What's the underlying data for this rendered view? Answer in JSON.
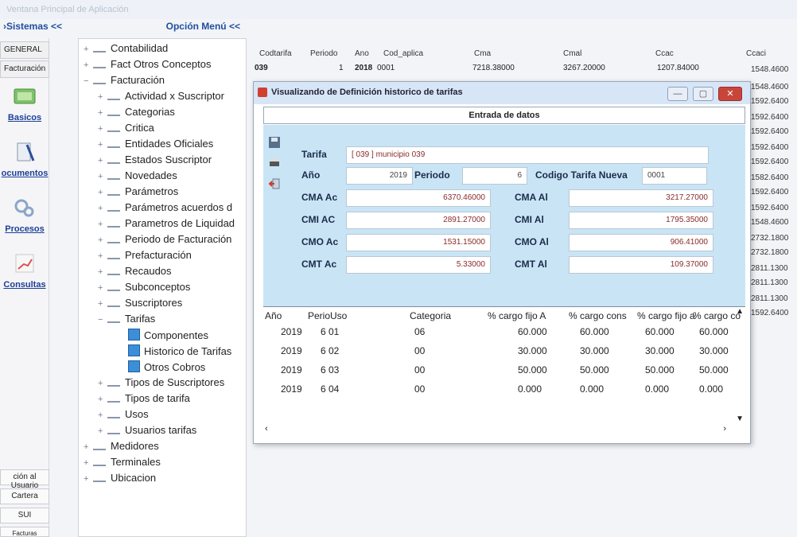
{
  "window": {
    "title": "Ventana Principal de Aplicación"
  },
  "header": {
    "sistemas_label": "›Sistemas <<",
    "opcion_menu_label": "Opción Menú <<"
  },
  "sidebar": {
    "tabs": [
      "GENERAL",
      "Facturación"
    ],
    "big_items": [
      "Basicos",
      "ocumentos",
      "Procesos",
      "Consultas"
    ],
    "bottom_items": [
      "ción al Usuario",
      "Cartera",
      "SUI",
      "Facturas"
    ]
  },
  "tree": {
    "items": [
      "Contabilidad",
      "Fact Otros Conceptos",
      "Facturación",
      "Actividad x Suscriptor",
      "Categorias",
      "Critica",
      "Entidades Oficiales",
      "Estados Suscriptor",
      "Novedades",
      "Parámetros",
      "Parámetros acuerdos d",
      "Parametros de Liquidad",
      "Periodo de Facturación",
      "Prefacturación",
      "Recaudos",
      "Subconceptos",
      "Suscriptores",
      "Tarifas",
      "Componentes",
      "Historico de Tarifas",
      "Otros Cobros",
      "Tipos de Suscriptores",
      "Tipos de tarifa",
      "Usos",
      "Usuarios tarifas",
      "Medidores",
      "Terminales",
      "Ubicacion"
    ]
  },
  "main_grid": {
    "headers": [
      "Codtarifa",
      "Periodo",
      "Ano",
      "Cod_aplica",
      "Cma",
      "Cmal",
      "Ccac",
      "Ccaci"
    ],
    "row1": [
      "039",
      "1",
      "2018",
      "0001",
      "7218.38000",
      "3267.20000",
      "1207.84000"
    ],
    "ccaci_values": [
      "1548.4600",
      "1548.4600",
      "1592.6400",
      "1592.6400",
      "1592.6400",
      "1592.6400",
      "1592.6400",
      "1582.6400",
      "1592.6400",
      "1592.6400",
      "1548.4600",
      "2732.1800",
      "2732.1800",
      "2811.1300",
      "2811.1300",
      "2811.1300",
      "1592.6400"
    ]
  },
  "modal": {
    "title": "Visualizando de Definición historico de tarifas",
    "entrada_label": "Entrada de datos",
    "form": {
      "tarifa_label": "Tarifa",
      "tarifa_value": "[ 039 ] municipio 039",
      "ano_label": "Año",
      "ano_value": "2019",
      "periodo_label": "Periodo",
      "periodo_value": "6",
      "codigo_label": "Codigo Tarifa Nueva",
      "codigo_value": "0001",
      "cma_ac_label": "CMA Ac",
      "cma_ac_value": "6370.46000",
      "cma_al_label": "CMA Al",
      "cma_al_value": "3217.27000",
      "cmi_ac_label": "CMI AC",
      "cmi_ac_value": "2891.27000",
      "cmi_al_label": "CMI Al",
      "cmi_al_value": "1795.35000",
      "cmo_ac_label": "CMO Ac",
      "cmo_ac_value": "1531.15000",
      "cmo_al_label": "CMO Al",
      "cmo_al_value": "906.41000",
      "cmt_ac_label": "CMT Ac",
      "cmt_ac_value": "5.33000",
      "cmt_al_label": "CMT Al",
      "cmt_al_value": "109.37000"
    },
    "grid": {
      "headers": [
        "Año",
        "PerioUso",
        "Categoria",
        "% cargo fijo A",
        "% cargo cons",
        "% cargo fijo a",
        "% cargo co"
      ],
      "rows": [
        [
          "2019",
          "6 01",
          "06",
          "60.000",
          "60.000",
          "60.000",
          "60.000"
        ],
        [
          "2019",
          "6 02",
          "00",
          "30.000",
          "30.000",
          "30.000",
          "30.000"
        ],
        [
          "2019",
          "6 03",
          "00",
          "50.000",
          "50.000",
          "50.000",
          "50.000"
        ],
        [
          "2019",
          "6 04",
          "00",
          "0.000",
          "0.000",
          "0.000",
          "0.000"
        ]
      ]
    }
  }
}
